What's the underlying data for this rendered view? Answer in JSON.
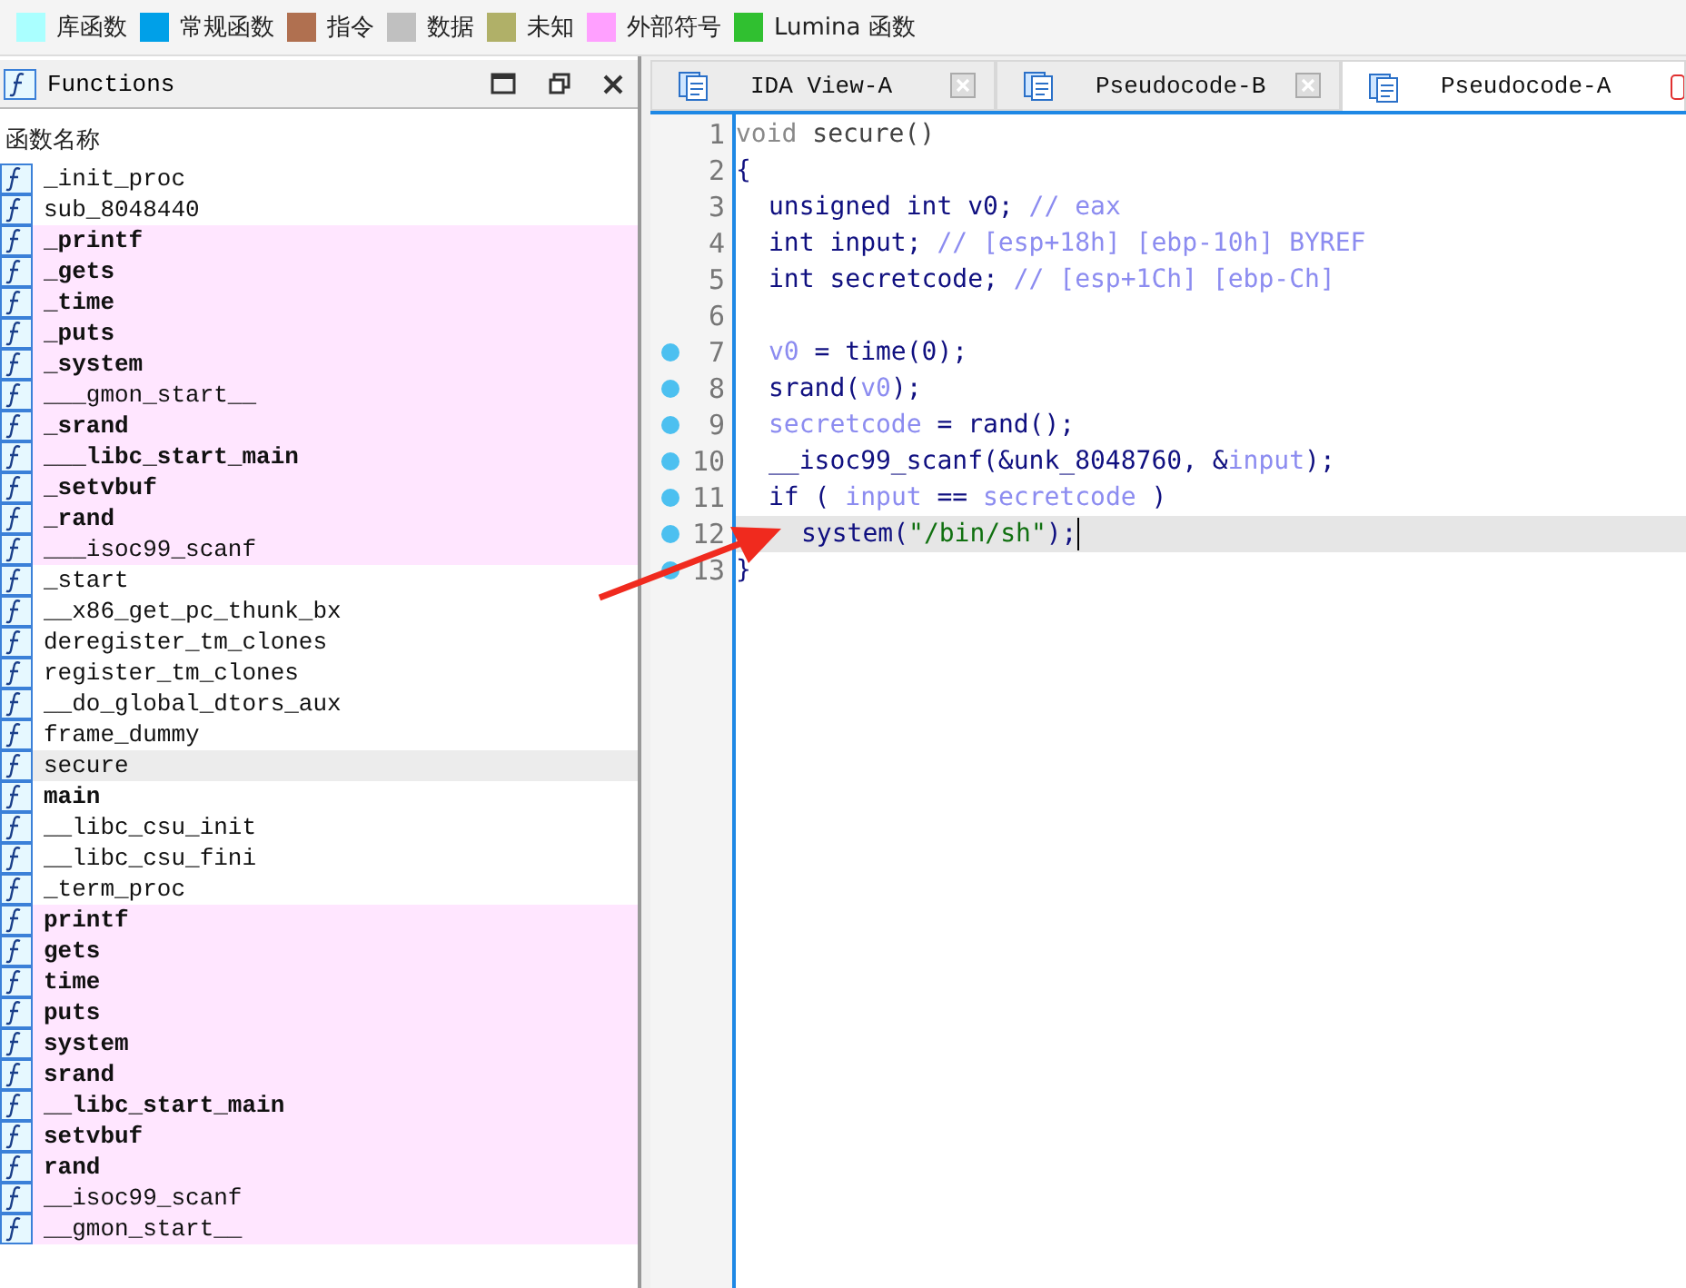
{
  "legend": [
    {
      "label": "库函数",
      "color": "#aaffff"
    },
    {
      "label": "常规函数",
      "color": "#00a0e8"
    },
    {
      "label": "指令",
      "color": "#b07050"
    },
    {
      "label": "数据",
      "color": "#c0c0c0"
    },
    {
      "label": "未知",
      "color": "#b0b068"
    },
    {
      "label": "外部符号",
      "color": "#ffa0ff"
    },
    {
      "label": "Lumina 函数",
      "color": "#30c030"
    }
  ],
  "functions_panel": {
    "title": "Functions",
    "column_header": "函数名称",
    "rows": [
      {
        "name": "_init_proc",
        "bold": false,
        "kind": "regular",
        "selected": false
      },
      {
        "name": "sub_8048440",
        "bold": false,
        "kind": "regular",
        "selected": false
      },
      {
        "name": "_printf",
        "bold": true,
        "kind": "external",
        "selected": false
      },
      {
        "name": "_gets",
        "bold": true,
        "kind": "external",
        "selected": false
      },
      {
        "name": "_time",
        "bold": true,
        "kind": "external",
        "selected": false
      },
      {
        "name": "_puts",
        "bold": true,
        "kind": "external",
        "selected": false
      },
      {
        "name": "_system",
        "bold": true,
        "kind": "external",
        "selected": false
      },
      {
        "name": "___gmon_start__",
        "bold": false,
        "kind": "external",
        "selected": false
      },
      {
        "name": "_srand",
        "bold": true,
        "kind": "external",
        "selected": false
      },
      {
        "name": "___libc_start_main",
        "bold": true,
        "kind": "external",
        "selected": false
      },
      {
        "name": "_setvbuf",
        "bold": true,
        "kind": "external",
        "selected": false
      },
      {
        "name": "_rand",
        "bold": true,
        "kind": "external",
        "selected": false
      },
      {
        "name": "___isoc99_scanf",
        "bold": false,
        "kind": "external",
        "selected": false
      },
      {
        "name": "_start",
        "bold": false,
        "kind": "regular",
        "selected": false
      },
      {
        "name": "__x86_get_pc_thunk_bx",
        "bold": false,
        "kind": "regular",
        "selected": false
      },
      {
        "name": "deregister_tm_clones",
        "bold": false,
        "kind": "regular",
        "selected": false
      },
      {
        "name": "register_tm_clones",
        "bold": false,
        "kind": "regular",
        "selected": false
      },
      {
        "name": "__do_global_dtors_aux",
        "bold": false,
        "kind": "regular",
        "selected": false
      },
      {
        "name": "frame_dummy",
        "bold": false,
        "kind": "regular",
        "selected": false
      },
      {
        "name": "secure",
        "bold": false,
        "kind": "regular",
        "selected": true
      },
      {
        "name": "main",
        "bold": true,
        "kind": "regular",
        "selected": false
      },
      {
        "name": "__libc_csu_init",
        "bold": false,
        "kind": "regular",
        "selected": false
      },
      {
        "name": "__libc_csu_fini",
        "bold": false,
        "kind": "regular",
        "selected": false
      },
      {
        "name": "_term_proc",
        "bold": false,
        "kind": "regular",
        "selected": false
      },
      {
        "name": "printf",
        "bold": true,
        "kind": "external",
        "selected": false
      },
      {
        "name": "gets",
        "bold": true,
        "kind": "external",
        "selected": false
      },
      {
        "name": "time",
        "bold": true,
        "kind": "external",
        "selected": false
      },
      {
        "name": "puts",
        "bold": true,
        "kind": "external",
        "selected": false
      },
      {
        "name": "system",
        "bold": true,
        "kind": "external",
        "selected": false
      },
      {
        "name": "srand",
        "bold": true,
        "kind": "external",
        "selected": false
      },
      {
        "name": "__libc_start_main",
        "bold": true,
        "kind": "external",
        "selected": false
      },
      {
        "name": "setvbuf",
        "bold": true,
        "kind": "external",
        "selected": false
      },
      {
        "name": "rand",
        "bold": true,
        "kind": "external",
        "selected": false
      },
      {
        "name": "__isoc99_scanf",
        "bold": false,
        "kind": "external",
        "selected": false
      },
      {
        "name": "__gmon_start__",
        "bold": false,
        "kind": "external",
        "selected": false
      }
    ]
  },
  "tabs": [
    {
      "label": "IDA View-A",
      "selected": false
    },
    {
      "label": "Pseudocode-B",
      "selected": false
    },
    {
      "label": "Pseudocode-A",
      "selected": true
    }
  ],
  "code_lines": [
    {
      "number": "1",
      "kind": "top",
      "breakpoint": false,
      "current": false,
      "tokens": [
        {
          "kind": "keyword",
          "text": "void"
        },
        {
          "kind": "plain",
          "text": " secure()"
        }
      ]
    },
    {
      "number": "2",
      "kind": "top",
      "breakpoint": false,
      "current": false,
      "tokens": [
        {
          "kind": "code",
          "text": "{"
        }
      ]
    },
    {
      "number": "3",
      "kind": "body",
      "breakpoint": false,
      "current": false,
      "tokens": [
        {
          "kind": "code",
          "text": "unsigned int v0; "
        },
        {
          "kind": "comment",
          "text": "// eax"
        }
      ]
    },
    {
      "number": "4",
      "kind": "body",
      "breakpoint": false,
      "current": false,
      "tokens": [
        {
          "kind": "code",
          "text": "int input; "
        },
        {
          "kind": "comment",
          "text": "// [esp+18h] [ebp-10h] BYREF"
        }
      ]
    },
    {
      "number": "5",
      "kind": "body",
      "breakpoint": false,
      "current": false,
      "tokens": [
        {
          "kind": "code",
          "text": "int secretcode; "
        },
        {
          "kind": "comment",
          "text": "// [esp+1Ch] [ebp-Ch]"
        }
      ]
    },
    {
      "number": "6",
      "breakpoint": false,
      "current": false
    },
    {
      "number": "7",
      "kind": "body",
      "breakpoint": true,
      "current": false,
      "tokens": [
        {
          "kind": "var",
          "text": "v0"
        },
        {
          "kind": "code",
          "text": " = time(0);"
        }
      ]
    },
    {
      "number": "8",
      "kind": "body",
      "breakpoint": true,
      "current": false,
      "tokens": [
        {
          "kind": "code",
          "text": "srand("
        },
        {
          "kind": "var",
          "text": "v0"
        },
        {
          "kind": "code",
          "text": ");"
        }
      ]
    },
    {
      "number": "9",
      "kind": "body",
      "breakpoint": true,
      "current": false,
      "tokens": [
        {
          "kind": "var",
          "text": "secretcode"
        },
        {
          "kind": "code",
          "text": " = rand();"
        }
      ]
    },
    {
      "number": "10",
      "kind": "body",
      "breakpoint": true,
      "current": false,
      "tokens": [
        {
          "kind": "code",
          "text": "__isoc99_scanf(&unk_8048760, &"
        },
        {
          "kind": "var",
          "text": "input"
        },
        {
          "kind": "code",
          "text": ");"
        }
      ]
    },
    {
      "number": "11",
      "kind": "body",
      "breakpoint": true,
      "current": false,
      "tokens": [
        {
          "kind": "code",
          "text": "if ( "
        },
        {
          "kind": "var",
          "text": "input"
        },
        {
          "kind": "code",
          "text": " == "
        },
        {
          "kind": "var",
          "text": "secretcode"
        },
        {
          "kind": "code",
          "text": " )"
        }
      ]
    },
    {
      "number": "12",
      "kind": "inner",
      "breakpoint": true,
      "current": true,
      "tokens": [
        {
          "kind": "code",
          "text": "system("
        },
        {
          "kind": "string",
          "text": "\"/bin/sh\""
        },
        {
          "kind": "code",
          "text": ");"
        }
      ]
    },
    {
      "number": "13",
      "kind": "top",
      "breakpoint": true,
      "current": false,
      "tokens": [
        {
          "kind": "code",
          "text": "}"
        }
      ]
    }
  ]
}
